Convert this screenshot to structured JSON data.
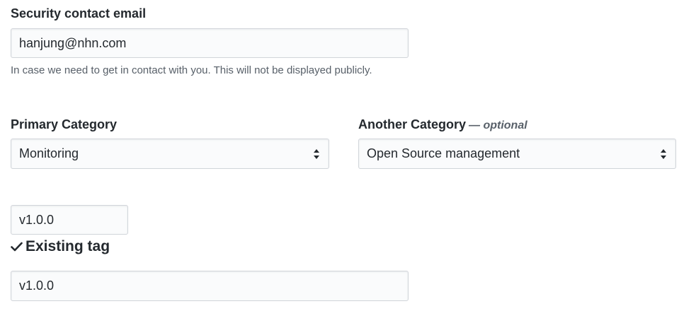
{
  "security": {
    "label": "Security contact email",
    "value": "hanjung@nhn.com",
    "note": "In case we need to get in contact with you. This will not be displayed publicly."
  },
  "primary_category": {
    "label": "Primary Category",
    "selected": "Monitoring"
  },
  "another_category": {
    "label": "Another Category",
    "optional": "— optional",
    "selected": "Open Source management"
  },
  "tag": {
    "value": "v1.0.0",
    "status": "Existing tag"
  },
  "release": {
    "value": "v1.0.0"
  },
  "icons": {
    "select_arrows": "select-arrows-icon",
    "check": "check-icon"
  }
}
